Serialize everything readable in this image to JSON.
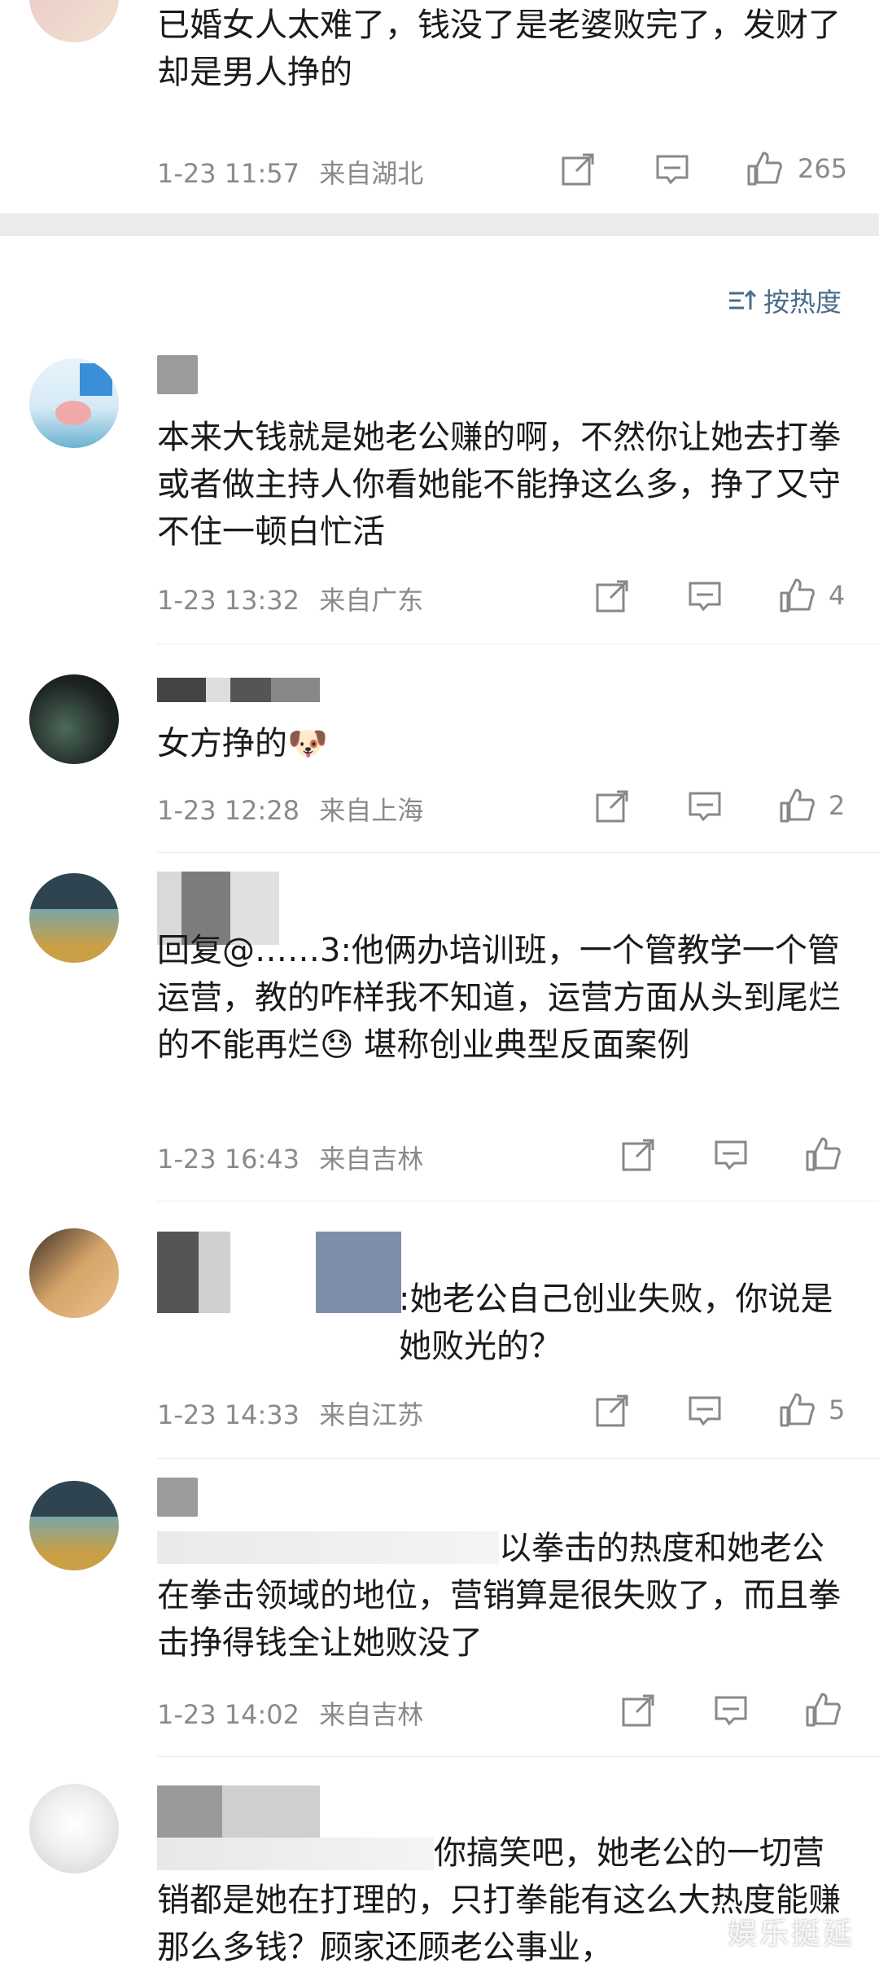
{
  "top_comment": {
    "text": "已婚女人太难了，钱没了是老婆败完了，发财了却是男人挣的",
    "time": "1-23 11:57",
    "location": "来自湖北",
    "likes": "265"
  },
  "sort": {
    "label": "按热度"
  },
  "comments": [
    {
      "text": "本来大钱就是她老公赚的啊，不然你让她去打拳或者做主持人你看她能不能挣这么多，挣了又守不住一顿白忙活",
      "time": "1-23 13:32",
      "location": "来自广东",
      "likes": "4"
    },
    {
      "text": "女方挣的🐶",
      "time": "1-23 12:28",
      "location": "来自上海",
      "likes": "2"
    },
    {
      "text": "回复@……3:他俩办培训班，一个管教学一个管运营，教的咋样我不知道，运营方面从头到尾烂的不能再烂😓 堪称创业典型反面案例",
      "time": "1-23 16:43",
      "location": "来自吉林",
      "likes": ""
    },
    {
      "text": ":她老公自己创业失败，你说是她败光的？",
      "time": "1-23 14:33",
      "location": "来自江苏",
      "likes": "5"
    },
    {
      "text": "以拳击的热度和她老公在拳击领域的地位，营销算是很失败了，而且拳击挣得钱全让她败没了",
      "time": "1-23 14:02",
      "location": "来自吉林",
      "likes": ""
    },
    {
      "text": "你搞笑吧，她老公的一切营销都是她在打理的，只打拳能有这么大热度能赚那么多钱？顾家还顾老公事业，",
      "time": "",
      "location": "",
      "likes": ""
    }
  ],
  "watermark": "娱乐挺延",
  "colors": {
    "separator": "#ebebeb",
    "meta": "#8a8a8a",
    "sort": "#4a6c8a"
  }
}
